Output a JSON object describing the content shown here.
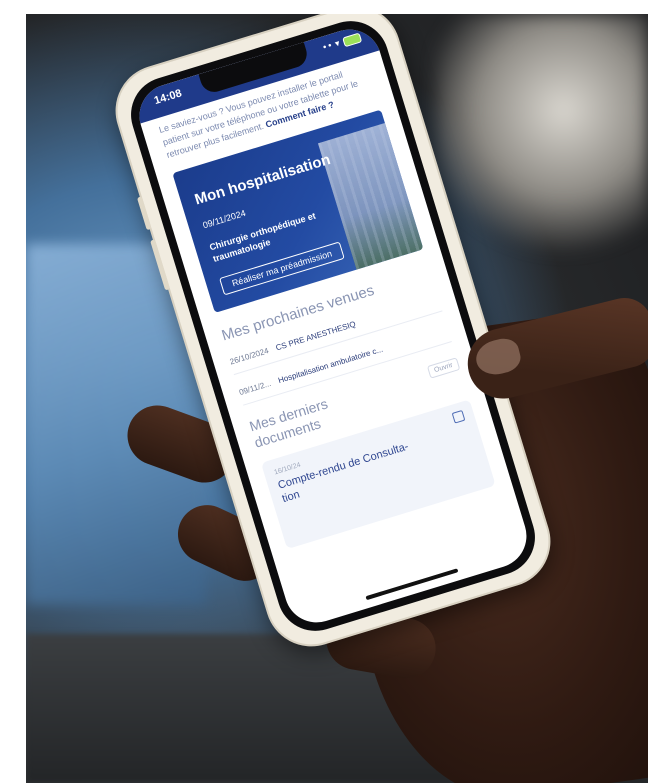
{
  "status_bar": {
    "time": "14:08",
    "signal": "•• ▾"
  },
  "tip": {
    "text": "Le saviez-vous ? Vous pouvez installer le portail patient sur votre téléphone ou votre tablette pour le retrouver plus facilement. ",
    "link": "Comment faire ?"
  },
  "hospitalisation": {
    "title": "Mon hospitalisation",
    "date": "09/11/2024",
    "speciality": "Chirurgie orthopédique et traumatologie",
    "button": "Réaliser ma préadmission"
  },
  "visits": {
    "title": "Mes prochaines venues",
    "items": [
      {
        "date": "26/10/2024",
        "label": "CS PRE ANESTHESIQ"
      },
      {
        "date": "09/11/2...",
        "label": "Hospitalisation ambulatoire c..."
      }
    ]
  },
  "documents": {
    "title": "Mes derniers documents",
    "open_label": "Ouvrir",
    "card": {
      "date": "16/10/24",
      "title": "Compte-rendu de Consulta-tion"
    }
  },
  "colors": {
    "brand_blue": "#1f3a8a",
    "card_blue": "#234ba3",
    "phone_case": "#f1ece0"
  }
}
